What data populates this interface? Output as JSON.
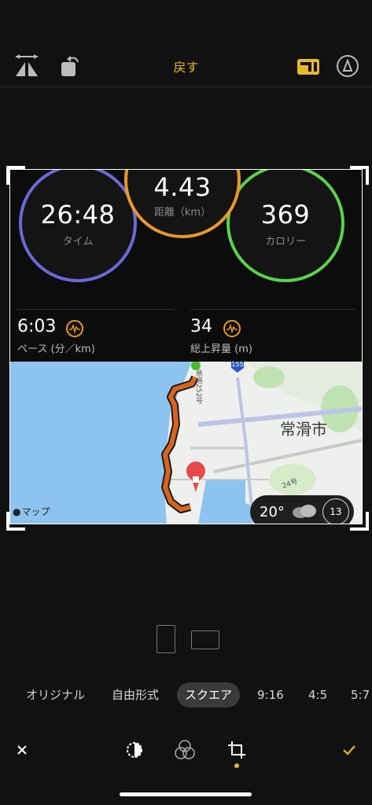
{
  "toolbar": {
    "back_label": "戻す",
    "icons": [
      "flip-icon",
      "rotate-icon",
      "aspect-ratio-icon",
      "markup-icon"
    ]
  },
  "workout": {
    "time": {
      "value": "26:48",
      "label": "タイム"
    },
    "distance": {
      "value": "4.43",
      "label": "距離（km）"
    },
    "calories": {
      "value": "369",
      "label": "カロリー"
    },
    "pace": {
      "value": "6:03",
      "label": "ペース (分／km)"
    },
    "elevation": {
      "value": "34",
      "label": "総上昇量 (m)"
    }
  },
  "map": {
    "attribution": "マップ",
    "city_label": "常滑市",
    "route_badge": "155",
    "road_label_1": "県道252号",
    "road_label_2": "24号",
    "temperature": "20°",
    "wind_value": "13"
  },
  "aspect_options": [
    {
      "label": "オリジナル"
    },
    {
      "label": "自由形式"
    },
    {
      "label": "スクエア",
      "selected": true
    },
    {
      "label": "9:16"
    },
    {
      "label": "4:5"
    },
    {
      "label": "5:7"
    }
  ],
  "colors": {
    "accent": "#e8b82a",
    "time_ring": "#6a6ad8",
    "distance_ring": "#e8982a",
    "calories_ring": "#5ad24a",
    "route": "#d8641e"
  }
}
